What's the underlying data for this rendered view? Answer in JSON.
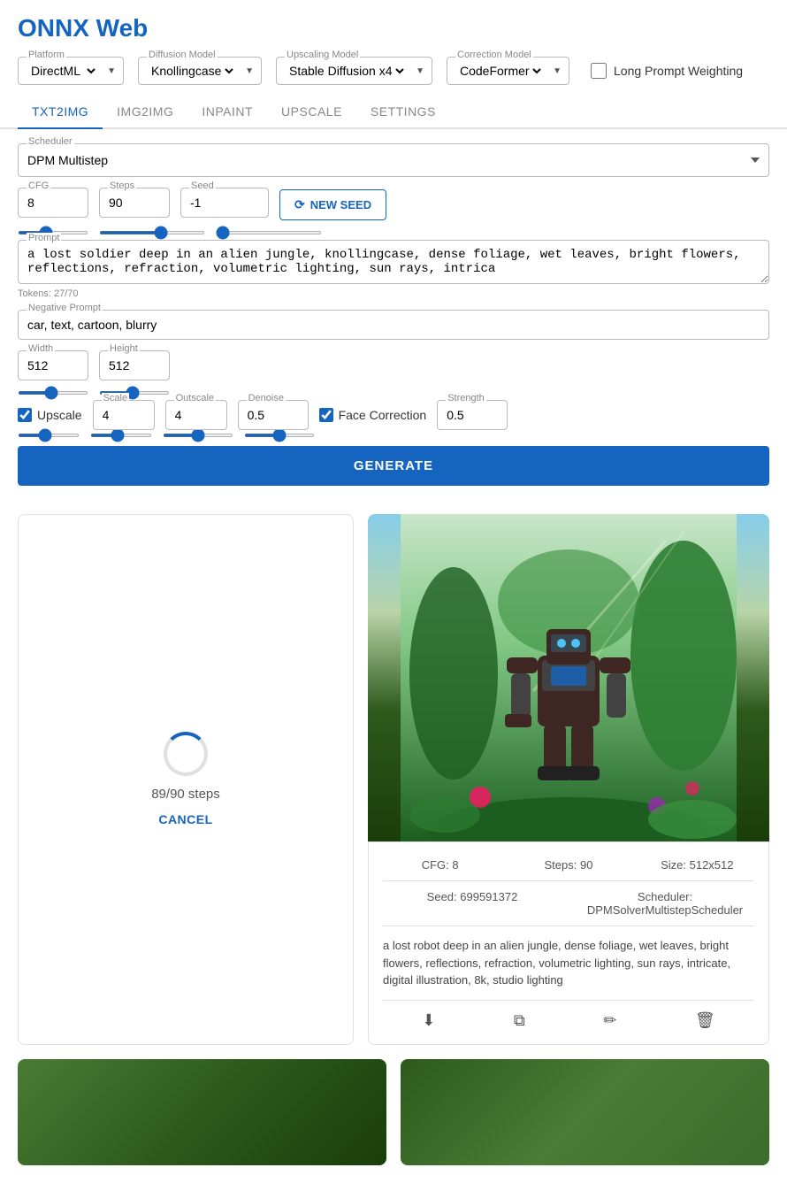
{
  "app": {
    "title": "ONNX Web"
  },
  "toolbar": {
    "platform_label": "Platform",
    "platform_value": "DirectML",
    "diffusion_label": "Diffusion Model",
    "diffusion_value": "Knollingcase",
    "upscaling_label": "Upscaling Model",
    "upscaling_value": "Stable Diffusion x4",
    "correction_label": "Correction Model",
    "correction_value": "CodeFormer",
    "long_prompt_label": "Long Prompt Weighting"
  },
  "tabs": {
    "items": [
      {
        "id": "txt2img",
        "label": "TXT2IMG",
        "active": true
      },
      {
        "id": "img2img",
        "label": "IMG2IMG",
        "active": false
      },
      {
        "id": "inpaint",
        "label": "INPAINT",
        "active": false
      },
      {
        "id": "upscale",
        "label": "UPSCALE",
        "active": false
      },
      {
        "id": "settings",
        "label": "SETTINGS",
        "active": false
      }
    ]
  },
  "form": {
    "scheduler_label": "Scheduler",
    "scheduler_value": "DPM Multistep",
    "cfg_label": "CFG",
    "cfg_value": "8",
    "steps_label": "Steps",
    "steps_value": "90",
    "seed_label": "Seed",
    "seed_value": "-1",
    "new_seed_label": "NEW SEED",
    "prompt_label": "Prompt",
    "prompt_value": "a lost soldier deep in an alien jungle, knollingcase, dense foliage, wet leaves, bright flowers, reflections, refraction, volumetric lighting, sun rays, intrica",
    "tokens_label": "Tokens: 27/70",
    "negative_label": "Negative Prompt",
    "negative_value": "car, text, cartoon, blurry",
    "width_label": "Width",
    "width_value": "512",
    "height_label": "Height",
    "height_value": "512",
    "upscale_label": "Upscale",
    "scale_label": "Scale",
    "scale_value": "4",
    "outscale_label": "Outscale",
    "outscale_value": "4",
    "denoise_label": "Denoise",
    "denoise_value": "0.5",
    "face_correction_label": "Face Correction",
    "strength_label": "Strength",
    "strength_value": "0.5",
    "generate_label": "GENERATE"
  },
  "progress": {
    "steps_text": "89/90 steps",
    "cancel_label": "CANCEL"
  },
  "image_info": {
    "cfg": "CFG: 8",
    "steps": "Steps: 90",
    "size": "Size: 512x512",
    "seed": "Seed: 699591372",
    "scheduler": "Scheduler: DPMSolverMultistepScheduler",
    "prompt": "a lost robot deep in an alien jungle, dense foliage, wet leaves, bright flowers, reflections, refraction, volumetric lighting, sun rays, intricate, digital illustration, 8k, studio lighting"
  },
  "actions": {
    "download": "⬇",
    "copy": "⧉",
    "edit": "✏",
    "delete": "🗑"
  },
  "colors": {
    "accent": "#1565c0",
    "border": "#bbb",
    "bg": "#ffffff"
  }
}
